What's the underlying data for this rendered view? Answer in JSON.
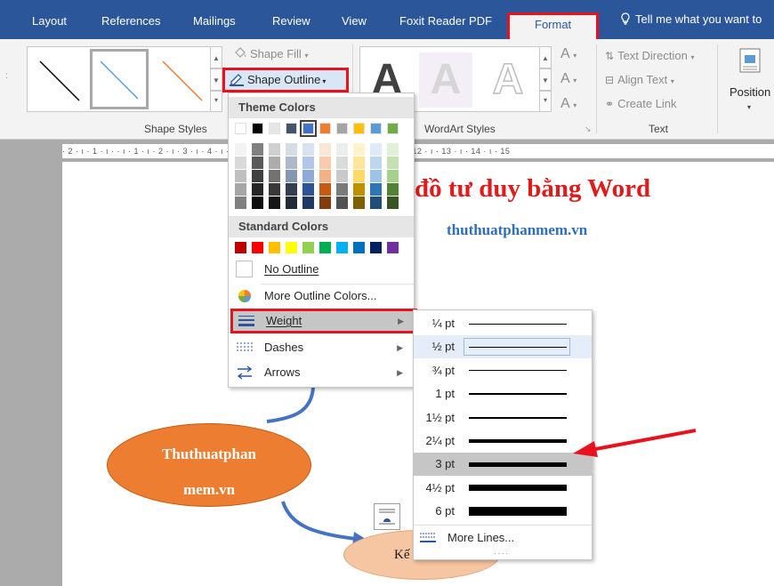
{
  "tabs": [
    {
      "label": "Layout",
      "active": false
    },
    {
      "label": "References",
      "active": false
    },
    {
      "label": "Mailings",
      "active": false
    },
    {
      "label": "Review",
      "active": false
    },
    {
      "label": "View",
      "active": false
    },
    {
      "label": "Foxit Reader PDF",
      "active": false
    },
    {
      "label": "Format",
      "active": true
    }
  ],
  "tell_me": "Tell me what you want to",
  "ribbon": {
    "shape_fill": "Shape Fill",
    "shape_outline": "Shape Outline",
    "shape_styles_label": "Shape Styles",
    "wordart_label": "WordArt Styles",
    "wordart_glyph": "A",
    "text_direction": "Text Direction",
    "align_text": "Align Text",
    "create_link": "Create Link",
    "text_label": "Text",
    "position": "Position"
  },
  "ruler_text": "· 2 · ı · 1 · ı ·  · ı · 1 · ı · 2 · ı · 3 · ı · 4 · ı · 5 · ı · 6 · ı · 7 · ı · 8 · ı · 9 · ı · 10 · ı · 11 · ı · 12 · ı · 13 · ı · 14 · ı · 15",
  "document": {
    "title": "đồ tư duy bằng Word",
    "subtitle": "thuthuatphanmem.vn",
    "main_node_line1": "Thuthuatphan",
    "main_node_line2": "mem.vn",
    "small_node": "Kế"
  },
  "outline_menu": {
    "theme_colors_label": "Theme Colors",
    "standard_colors_label": "Standard Colors",
    "no_outline": "No Outline",
    "more_outline_colors": "More Outline Colors...",
    "weight": "Weight",
    "dashes": "Dashes",
    "arrows": "Arrows",
    "theme_colors": [
      "#ffffff",
      "#000000",
      "#e7e6e6",
      "#44546a",
      "#4472c4",
      "#ed7d31",
      "#a5a5a5",
      "#ffc000",
      "#5b9bd5",
      "#70ad47"
    ],
    "theme_shades": [
      [
        "#f2f2f2",
        "#d9d9d9",
        "#bfbfbf",
        "#a6a6a6",
        "#808080"
      ],
      [
        "#808080",
        "#595959",
        "#404040",
        "#262626",
        "#0d0d0d"
      ],
      [
        "#d0cece",
        "#aeabab",
        "#757171",
        "#3a3838",
        "#171616"
      ],
      [
        "#d6dce4",
        "#adb9ca",
        "#8496b0",
        "#333f4f",
        "#222a35"
      ],
      [
        "#d9e2f3",
        "#b4c6e7",
        "#8eaadb",
        "#2f5496",
        "#1f3864"
      ],
      [
        "#fbe5d5",
        "#f7cbac",
        "#f4b183",
        "#c55a11",
        "#833c0b"
      ],
      [
        "#ededed",
        "#dbdbdb",
        "#c9c9c9",
        "#7b7b7b",
        "#525252"
      ],
      [
        "#fff2cc",
        "#ffe599",
        "#ffd966",
        "#bf9000",
        "#7f6000"
      ],
      [
        "#deebf6",
        "#bdd7ee",
        "#9dc3e6",
        "#2e75b5",
        "#1e4e79"
      ],
      [
        "#e2efd9",
        "#c5e0b3",
        "#a8d08d",
        "#538135",
        "#375623"
      ]
    ],
    "standard_colors": [
      "#c00000",
      "#ff0000",
      "#ffc000",
      "#ffff00",
      "#92d050",
      "#00b050",
      "#00b0f0",
      "#0070c0",
      "#002060",
      "#7030a0"
    ],
    "selected_theme_index": 4
  },
  "weight_menu": {
    "options": [
      {
        "label": "¼ pt",
        "weight_pt": 0.25
      },
      {
        "label": "½ pt",
        "weight_pt": 0.5,
        "current": true
      },
      {
        "label": "¾ pt",
        "weight_pt": 0.75
      },
      {
        "label": "1 pt",
        "weight_pt": 1
      },
      {
        "label": "1½ pt",
        "weight_pt": 1.5
      },
      {
        "label": "2¼ pt",
        "weight_pt": 2.25
      },
      {
        "label": "3 pt",
        "weight_pt": 3,
        "hover": true
      },
      {
        "label": "4½ pt",
        "weight_pt": 4.5
      },
      {
        "label": "6 pt",
        "weight_pt": 6
      }
    ],
    "more_lines": "More Lines..."
  },
  "colors": {
    "titlebar": "#2b579a",
    "highlight_red": "#e8121f",
    "title_red": "#e01b1b",
    "subtitle_blue": "#2e6fb9",
    "node_orange": "#ed7d31",
    "node_light": "#f6c5a1",
    "connector_blue": "#4472c4"
  }
}
